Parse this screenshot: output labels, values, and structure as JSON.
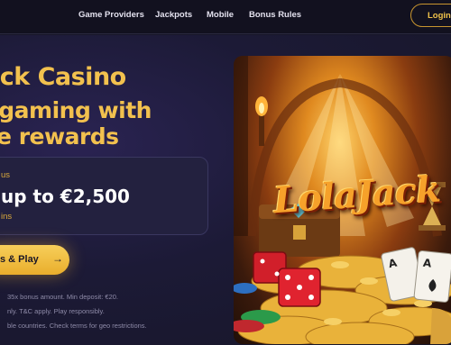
{
  "nav": {
    "items": [
      {
        "label": "Game Providers"
      },
      {
        "label": "Jackpots"
      },
      {
        "label": "Mobile"
      },
      {
        "label": "Bonus Rules"
      }
    ],
    "login_label": "Login"
  },
  "hero": {
    "title_line1": "ack Casino",
    "title_line2": "l gaming with",
    "title_line3": "ze rewards",
    "offer": {
      "kicker": "us",
      "headline": "up to €2,500",
      "sub": "ins"
    },
    "cta_label": "s & Play",
    "fine_print": [
      "35x bonus amount. Min deposit: €20.",
      "nly. T&C apply. Play responsibly.",
      "ble countries. Check terms for geo restrictions."
    ],
    "image_logo_text": "LolaJack"
  },
  "colors": {
    "accent_gold": "#f2c14e",
    "background": "#161527",
    "card": "#23213f"
  }
}
